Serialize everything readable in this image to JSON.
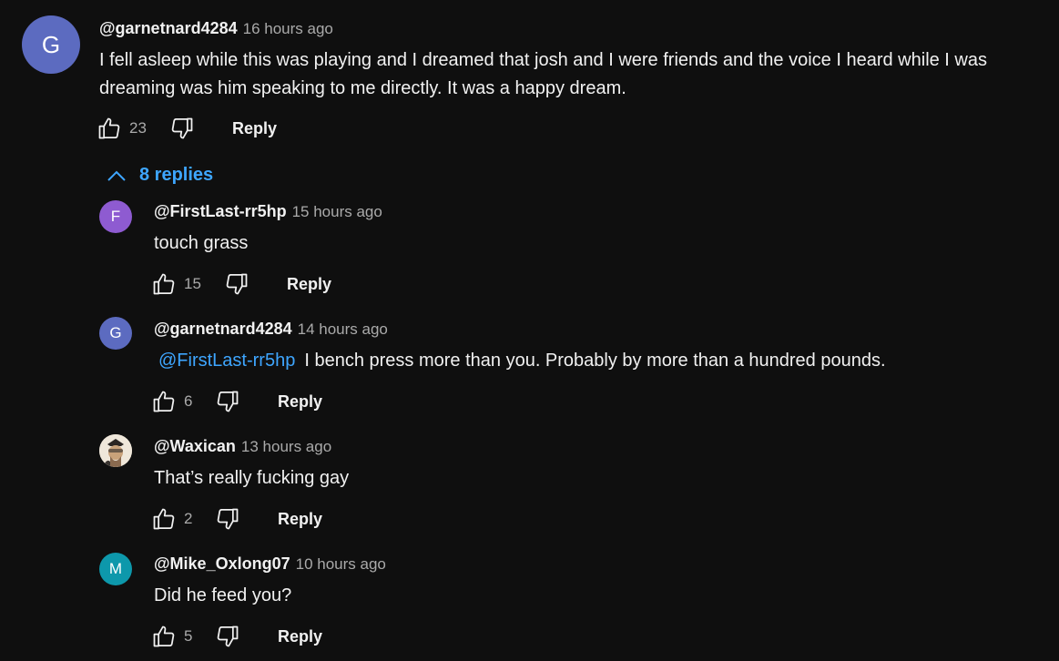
{
  "colors": {
    "background": "#0f0f0f",
    "text": "#f1f1f1",
    "muted": "#aaaaaa",
    "link": "#3ea6ff"
  },
  "top_comment": {
    "avatar_letter": "G",
    "avatar_color": "#5c6bc0",
    "author": "@garnetnard4284",
    "time": "16 hours ago",
    "text_line1": "I fell asleep while this was playing and I dreamed that josh and I were friends and the voice I heard while I was",
    "text_line2": "dreaming was him speaking to me directly.  It was a happy dream.",
    "likes": "23",
    "reply_label": "Reply",
    "icons": [
      "thumb-up-icon",
      "thumb-down-icon"
    ]
  },
  "replies_toggle": {
    "label": "8 replies",
    "icon": "chevron-up-icon"
  },
  "replies": [
    {
      "avatar_letter": "F",
      "avatar_color": "#8e5bd1",
      "author": "@FirstLast-rr5hp",
      "time": "15 hours ago",
      "mention": "",
      "text": "touch grass",
      "likes": "15",
      "reply_label": "Reply"
    },
    {
      "avatar_letter": "G",
      "avatar_color": "#5c6bc0",
      "author": "@garnetnard4284",
      "time": "14 hours ago",
      "mention": "@FirstLast-rr5hp",
      "text": "I bench press more than you. Probably by more than a hundred pounds.",
      "likes": "6",
      "reply_label": "Reply"
    },
    {
      "avatar_letter": "",
      "avatar_color": "#e6ddd0",
      "author": "@Waxican",
      "time": "13 hours ago",
      "mention": "",
      "text": "That’s really fucking gay",
      "likes": "2",
      "reply_label": "Reply"
    },
    {
      "avatar_letter": "M",
      "avatar_color": "#0d98ab",
      "author": "@Mike_Oxlong07",
      "time": "10 hours ago",
      "mention": "",
      "text": "Did he feed you?",
      "likes": "5",
      "reply_label": "Reply"
    }
  ]
}
